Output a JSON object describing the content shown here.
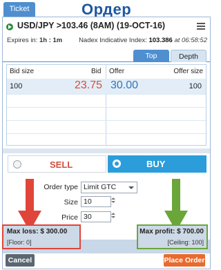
{
  "window": {
    "ticket_tab": "Ticket",
    "overlay_title": "Ордер"
  },
  "instrument": {
    "name": "USD/JPY >103.46 (8AM) (19-OCT-16)",
    "status_icon": "play-circle-icon",
    "menu_icon": "hamburger-menu-icon"
  },
  "info": {
    "expires_label": "Expires in:",
    "expires_value": "1h : 1m",
    "index_label": "Nadex Indicative Index:",
    "index_value": "103.386",
    "index_time": "at 06:58:52"
  },
  "view_tabs": {
    "top": "Top",
    "depth": "Depth",
    "active": "Top"
  },
  "order_book": {
    "columns": {
      "bid_size": "Bid size",
      "bid": "Bid",
      "offer": "Offer",
      "offer_size": "Offer size"
    },
    "rows": [
      {
        "bid_size": "100",
        "bid": "23.75",
        "offer": "30.00",
        "offer_size": "100"
      }
    ]
  },
  "side": {
    "sell_label": "SELL",
    "buy_label": "BUY",
    "selected": "BUY"
  },
  "form": {
    "order_type_label": "Order type",
    "order_type_value": "Limit GTC",
    "size_label": "Size",
    "size_value": "10",
    "price_label": "Price",
    "price_value": "30"
  },
  "risk": {
    "max_loss_label": "Max loss:",
    "max_loss_value": "$ 300.00",
    "floor_text": "[Floor: 0]",
    "max_profit_label": "Max profit:",
    "max_profit_value": "$ 700.00",
    "ceiling_text": "[Ceiling: 100]"
  },
  "actions": {
    "cancel": "Cancel",
    "place_order": "Place Order"
  },
  "colors": {
    "accent": "#4f8fcf",
    "bid": "#d04f3f",
    "offer": "#2f75bd",
    "buy": "#2b9ddb",
    "place_order": "#e86a2d",
    "loss_highlight": "#e0453a",
    "profit_highlight": "#6aa63a"
  }
}
